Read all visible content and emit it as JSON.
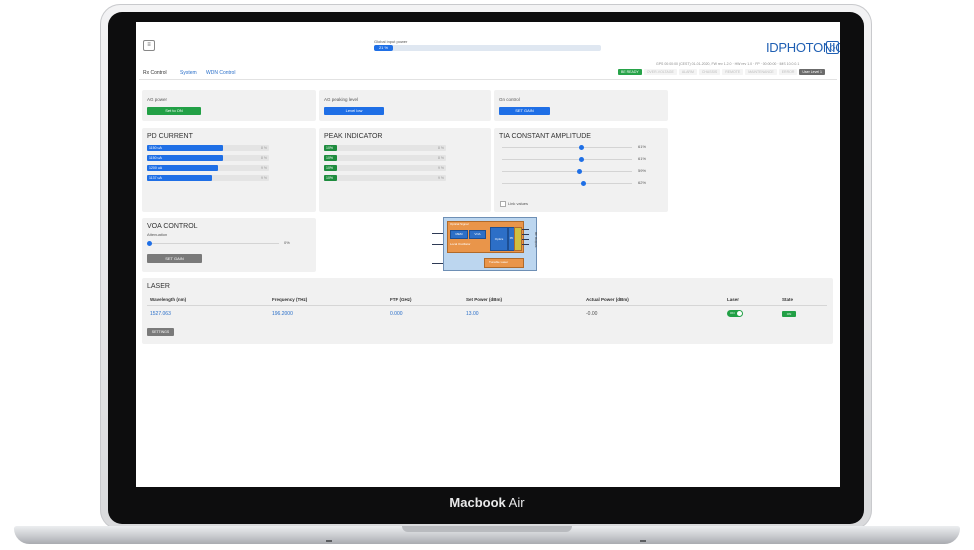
{
  "device": {
    "brand_bold": "Macbook",
    "brand_rest": " Air"
  },
  "app": {
    "menu_icon": "hamburger-icon",
    "global_input": {
      "label": "Global input power",
      "value": "21 %",
      "level_pct": 9
    },
    "logo_text": "IDPHOTONICS",
    "logo_icon": "logo-mark-icon",
    "status_text": "GPS 00:00:00 (CEST) 01-01-2020, FW rev 1.2.0  ·  HW rev 1.0  ·  FP  ·  00:00:00  ·  IMS 10.0.0.1",
    "badges": [
      {
        "label": "BE READY",
        "style": "green"
      },
      {
        "label": "OVER-VOLTAGE",
        "style": "faded"
      },
      {
        "label": "ALARM",
        "style": "faded"
      },
      {
        "label": "CHASSIS",
        "style": "faded"
      },
      {
        "label": "REMOTE",
        "style": "faded"
      },
      {
        "label": "MAINTENANCE",
        "style": "faded"
      },
      {
        "label": "ERROR",
        "style": "faded"
      },
      {
        "label": "User Level 1",
        "style": "dark"
      }
    ],
    "tabs": [
      {
        "label": "Rx Control",
        "active": true
      },
      {
        "label": "System",
        "active": false
      },
      {
        "label": "WDN Control",
        "active": false
      }
    ]
  },
  "controls": {
    "agc_power": {
      "label": "AG power",
      "button": "Set to ON"
    },
    "agc_peaking": {
      "label": "AG peaking level",
      "button": "Level low"
    },
    "gain_control": {
      "label": "Gn control",
      "button": "SET GAIN"
    }
  },
  "pd_current": {
    "title": "PD CURRENT",
    "rows": [
      {
        "label": "1150 uA",
        "value": "8 %",
        "fill_pct": 62
      },
      {
        "label": "1150 uA",
        "value": "8 %",
        "fill_pct": 62
      },
      {
        "label": "1200 uA",
        "value": "9 %",
        "fill_pct": 58
      },
      {
        "label": "1137 uA",
        "value": "9 %",
        "fill_pct": 53
      }
    ]
  },
  "peak_indicator": {
    "title": "PEAK INDICATOR",
    "rows": [
      {
        "label": "10%",
        "value": "8 %",
        "fill_pct": 11
      },
      {
        "label": "10%",
        "value": "8 %",
        "fill_pct": 11
      },
      {
        "label": "10%",
        "value": "9 %",
        "fill_pct": 11
      },
      {
        "label": "10%",
        "value": "9 %",
        "fill_pct": 11
      }
    ]
  },
  "tia": {
    "title": "TIA CONSTANT AMPLITUDE",
    "rows": [
      {
        "value": "61%",
        "level_pct": 61
      },
      {
        "value": "61%",
        "level_pct": 61
      },
      {
        "value": "59%",
        "level_pct": 59
      },
      {
        "value": "62%",
        "level_pct": 62
      }
    ],
    "checkbox_label": "Link values"
  },
  "voa": {
    "title": "VOA CONTROL",
    "label": "Attenuation",
    "value": "0%",
    "level_pct": 0,
    "button": "SET GAIN"
  },
  "diagram": {
    "signal_label": "Optical Signal",
    "mem_label": "MEM",
    "voa_label": "VOA",
    "optics_label": "Optics",
    "lo_label": "Local Oscillator",
    "laser_label": "Tunable Laser",
    "outputs_label": "RF Outputs",
    "tia_label": "TIA",
    "pd_label": "PD"
  },
  "laser": {
    "title": "LASER",
    "headers": [
      "Wavelength (nm)",
      "Frequency (THz)",
      "FTF (GHz)",
      "Set Power (dBm)",
      "Actual Power (dBm)",
      "Laser",
      "State"
    ],
    "row": {
      "wavelength": "1527.063",
      "frequency": "196.2000",
      "ftf": "0.000",
      "set_power": "13.00",
      "actual_power": "-0.00",
      "laser_toggle": "ON",
      "state": "ON"
    },
    "settings_button": "SETTINGS"
  }
}
